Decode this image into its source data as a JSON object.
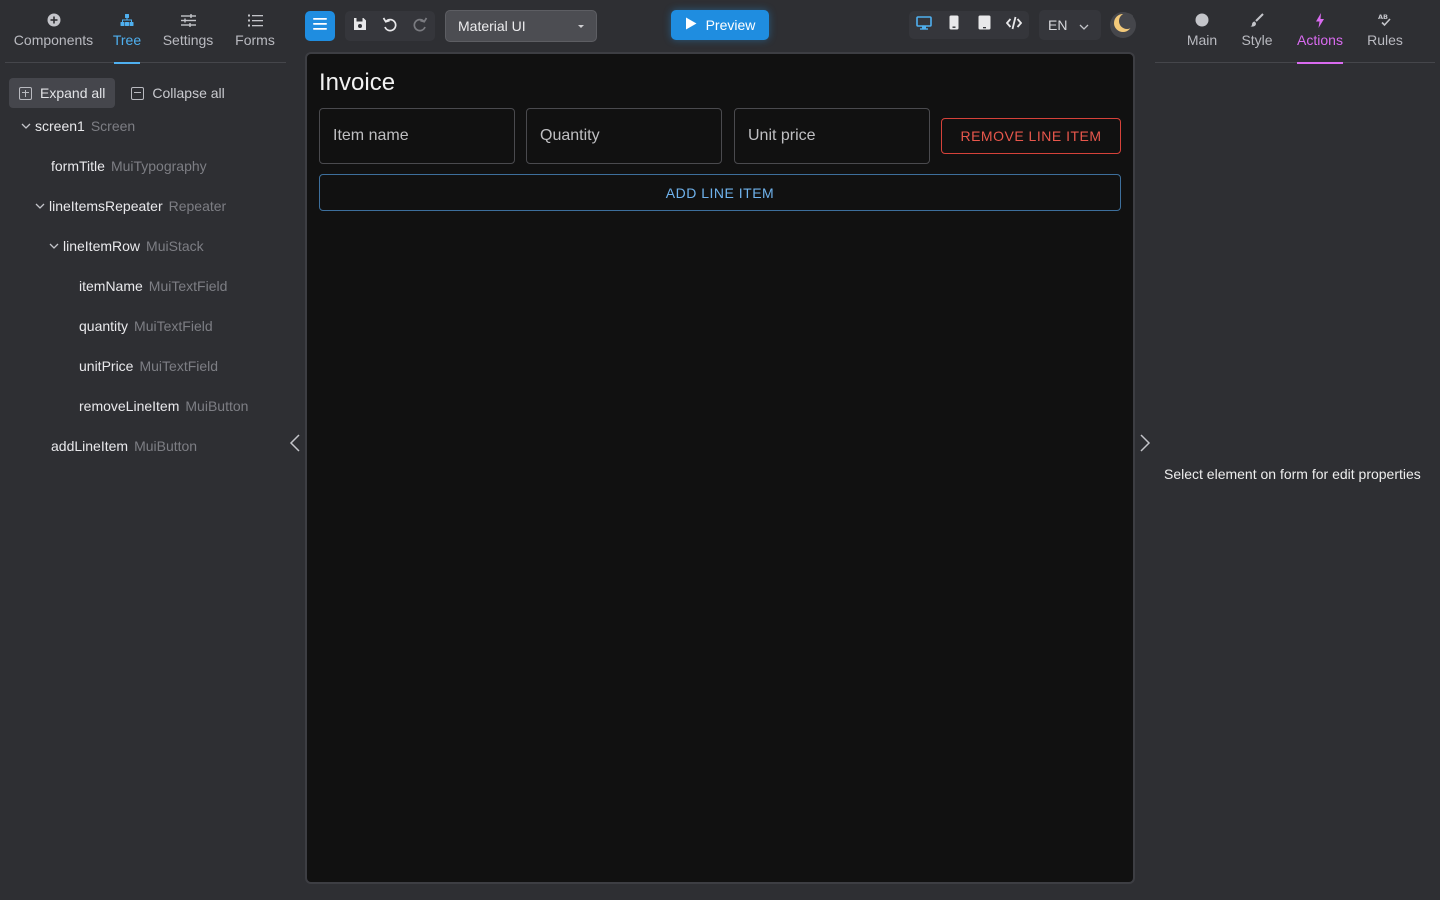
{
  "left_tabs": [
    {
      "label": "Components",
      "icon": "plus-circle-icon"
    },
    {
      "label": "Tree",
      "icon": "tree-icon",
      "active": true
    },
    {
      "label": "Settings",
      "icon": "sliders-icon"
    },
    {
      "label": "Forms",
      "icon": "list-icon"
    }
  ],
  "tree_actions": {
    "expand_all": "Expand all",
    "collapse_all": "Collapse all"
  },
  "tree": [
    {
      "name": "screen1",
      "type": "Screen",
      "depth": 0,
      "expanded": true
    },
    {
      "name": "formTitle",
      "type": "MuiTypography",
      "depth": 1
    },
    {
      "name": "lineItemsRepeater",
      "type": "Repeater",
      "depth": 1,
      "expanded": true
    },
    {
      "name": "lineItemRow",
      "type": "MuiStack",
      "depth": 2,
      "expanded": true
    },
    {
      "name": "itemName",
      "type": "MuiTextField",
      "depth": 3
    },
    {
      "name": "quantity",
      "type": "MuiTextField",
      "depth": 3
    },
    {
      "name": "unitPrice",
      "type": "MuiTextField",
      "depth": 3
    },
    {
      "name": "removeLineItem",
      "type": "MuiButton",
      "depth": 3
    },
    {
      "name": "addLineItem",
      "type": "MuiButton",
      "depth": 1
    }
  ],
  "toolbar": {
    "ui_library": "Material UI",
    "preview_label": "Preview",
    "language": "EN"
  },
  "form": {
    "title": "Invoice",
    "fields": {
      "item_name": "Item name",
      "quantity": "Quantity",
      "unit_price": "Unit price"
    },
    "remove_button": "REMOVE LINE ITEM",
    "add_button": "ADD LINE ITEM"
  },
  "right_tabs": [
    {
      "label": "Main",
      "icon": "circle-icon"
    },
    {
      "label": "Style",
      "icon": "brush-icon"
    },
    {
      "label": "Actions",
      "icon": "lightning-icon",
      "active": true
    },
    {
      "label": "Rules",
      "icon": "rules-icon"
    }
  ],
  "properties_hint": "Select element on form for edit properties",
  "colors": {
    "accent_blue": "#1f8de0",
    "tree_active": "#4fb0f0",
    "actions_active": "#d96bf0",
    "danger": "#e8574c"
  }
}
